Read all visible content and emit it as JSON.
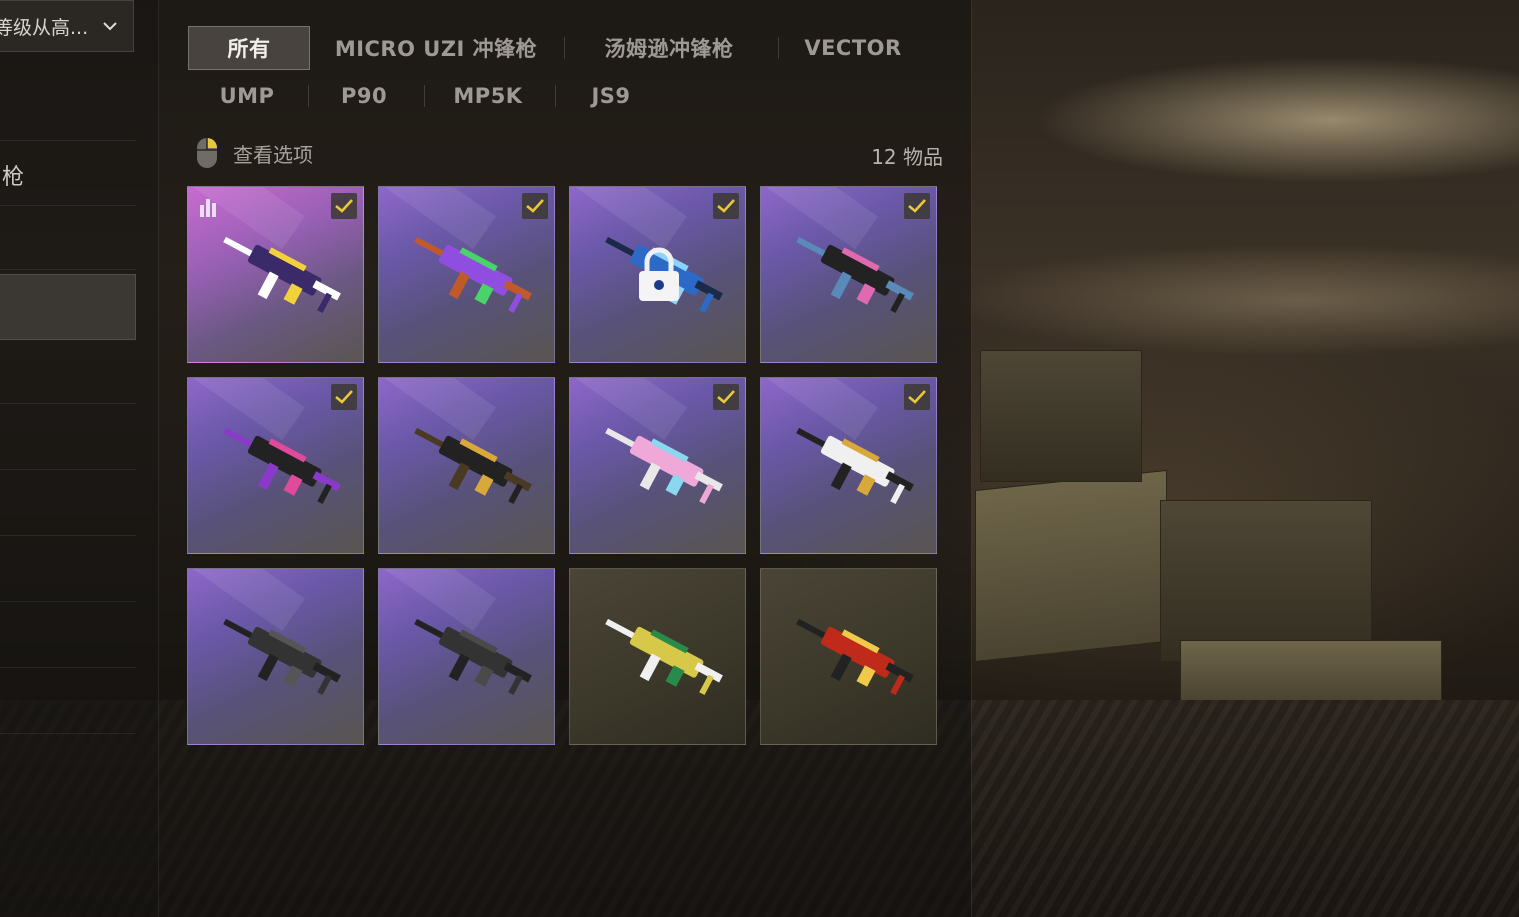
{
  "sort": {
    "label": "等级从高..."
  },
  "sidebar": {
    "items": [
      "枪",
      "",
      "",
      "",
      "",
      "",
      "",
      ""
    ]
  },
  "tabs": [
    "所有",
    "MICRO UZI 冲锋枪",
    "汤姆逊冲锋枪",
    "VECTOR",
    "UMP",
    "P90",
    "MP5K",
    "JS9"
  ],
  "active_tab": "所有",
  "view_options": {
    "label": "查看选项",
    "icon": "mouse-icon"
  },
  "item_count": "12 物品",
  "colors": {
    "accent": "#e9c83b",
    "panel": "#121010",
    "rarity_purple": "#8e67c9"
  },
  "items": [
    {
      "name": "mp5k-pro-skin",
      "icon": "smg-icon",
      "rarity": "pink",
      "equipped": true,
      "locked": false,
      "tier_icon": true
    },
    {
      "name": "vector-green-purple",
      "icon": "smg-icon",
      "rarity": "purple",
      "equipped": true,
      "locked": false
    },
    {
      "name": "ump-blue",
      "icon": "smg-icon",
      "rarity": "purple",
      "equipped": true,
      "locked": true
    },
    {
      "name": "micro-uzi-dark",
      "icon": "smg-icon",
      "rarity": "purple",
      "equipped": true,
      "locked": false
    },
    {
      "name": "thompson-pink",
      "icon": "smg-icon",
      "rarity": "purple",
      "equipped": true,
      "locked": false
    },
    {
      "name": "p90-gold",
      "icon": "smg-icon",
      "rarity": "purple",
      "equipped": false,
      "locked": false
    },
    {
      "name": "js9-pastel",
      "icon": "smg-icon",
      "rarity": "purple",
      "equipped": true,
      "locked": false
    },
    {
      "name": "p90-white-gold",
      "icon": "smg-icon",
      "rarity": "purple",
      "equipped": true,
      "locked": false
    },
    {
      "name": "ump-default",
      "icon": "smg-icon",
      "rarity": "purple",
      "equipped": false,
      "locked": false
    },
    {
      "name": "vector-default",
      "icon": "smg-icon",
      "rarity": "purple",
      "equipped": false,
      "locked": false
    },
    {
      "name": "vector-circuit",
      "icon": "smg-icon",
      "rarity": "brown",
      "equipped": false,
      "locked": false
    },
    {
      "name": "js9-red-pro",
      "icon": "smg-icon",
      "rarity": "brown",
      "equipped": false,
      "locked": false
    }
  ]
}
